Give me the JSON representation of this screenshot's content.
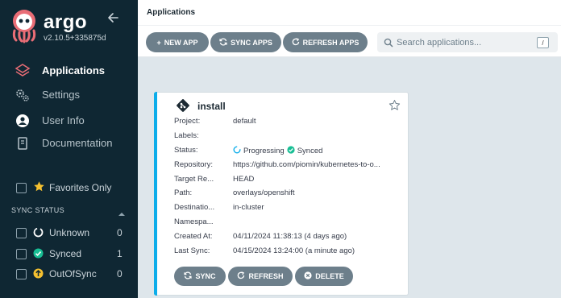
{
  "app": {
    "brand": "argo",
    "version": "v2.10.5+335875d"
  },
  "sidebar": {
    "nav": [
      {
        "label": "Applications",
        "icon": "layers-icon"
      },
      {
        "label": "Settings",
        "icon": "gears-icon"
      },
      {
        "label": "User Info",
        "icon": "user-icon"
      },
      {
        "label": "Documentation",
        "icon": "book-icon"
      }
    ],
    "favorites_label": "Favorites Only",
    "sync_status_title": "SYNC STATUS",
    "filters": [
      {
        "label": "Unknown",
        "count": "0",
        "icon": "unknown-circle-icon"
      },
      {
        "label": "Synced",
        "count": "1",
        "icon": "synced-check-icon"
      },
      {
        "label": "OutOfSync",
        "count": "0",
        "icon": "outofsync-arrow-icon"
      }
    ]
  },
  "header": {
    "title": "Applications",
    "buttons": {
      "new_app": "NEW APP",
      "sync_apps": "SYNC APPS",
      "refresh_apps": "REFRESH APPS"
    },
    "search_placeholder": "Search applications...",
    "search_shortcut": "/"
  },
  "card": {
    "name": "install",
    "fields": {
      "project": {
        "k": "Project:",
        "v": "default"
      },
      "labels": {
        "k": "Labels:",
        "v": ""
      },
      "status": {
        "k": "Status:",
        "health": "Progressing",
        "sync": "Synced"
      },
      "repository": {
        "k": "Repository:",
        "v": "https://github.com/piomin/kubernetes-to-o..."
      },
      "target": {
        "k": "Target Re...",
        "v": "HEAD"
      },
      "path": {
        "k": "Path:",
        "v": "overlays/openshift"
      },
      "destination": {
        "k": "Destinatio...",
        "v": "in-cluster"
      },
      "namespace": {
        "k": "Namespa...",
        "v": ""
      },
      "created": {
        "k": "Created At:",
        "v": "04/11/2024 11:38:13  (4 days ago)"
      },
      "lastsync": {
        "k": "Last Sync:",
        "v": "04/15/2024 13:24:00  (a minute ago)"
      }
    },
    "buttons": {
      "sync": "SYNC",
      "refresh": "REFRESH",
      "delete": "DELETE"
    }
  },
  "colors": {
    "sidebar_bg": "#0f2733",
    "button_gray": "#6d7f8b",
    "synced_green": "#18be94",
    "progressing_blue": "#0dadea",
    "outofsync_yellow": "#f4c030",
    "content_bg": "#dee6eb"
  }
}
